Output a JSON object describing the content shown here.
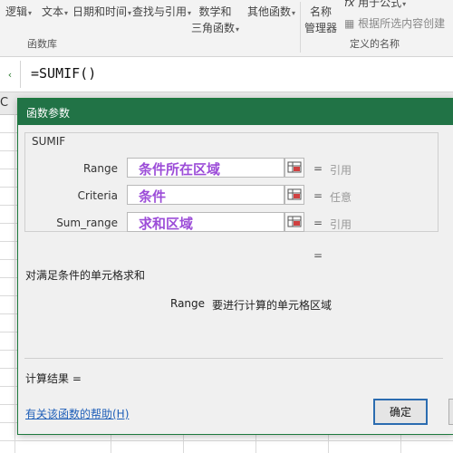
{
  "ribbon": {
    "buttons": [
      {
        "label": "逻辑"
      },
      {
        "label": "文本"
      },
      {
        "label": "日期和时间"
      },
      {
        "label": "查找与引用"
      },
      {
        "label": "数学和",
        "label2": "三角函数"
      },
      {
        "label": "其他函数"
      }
    ],
    "name_manager": {
      "line1": "名称",
      "line2": "管理器"
    },
    "use_in_formula": "用于公式",
    "create_from_selection": "根据所选内容创建",
    "group_function_library": "函数库",
    "group_defined_names": "定义的名称"
  },
  "formula_bar": {
    "formula": "=SUMIF()"
  },
  "sheet": {
    "column_header": "C"
  },
  "dialog": {
    "title": "函数参数",
    "function_name": "SUMIF",
    "args": [
      {
        "label": "Range",
        "value": "条件所在区域",
        "ref_type": "引用"
      },
      {
        "label": "Criteria",
        "value": "条件",
        "ref_type": "任意"
      },
      {
        "label": "Sum_range",
        "value": "求和区域",
        "ref_type": "引用"
      }
    ],
    "equals": "=",
    "result_equals": "=",
    "description": "对满足条件的单元格求和",
    "param_name": "Range",
    "param_description": "要进行计算的单元格区域",
    "calc_result": "计算结果 =",
    "help_link": "有关该函数的帮助(H)",
    "ok_label": "确定"
  }
}
